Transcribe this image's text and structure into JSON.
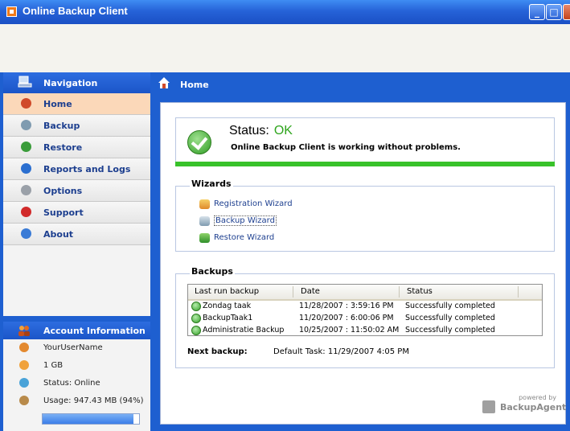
{
  "window": {
    "title": "Online Backup Client"
  },
  "nav": {
    "header": "Navigation",
    "items": [
      {
        "label": "Home",
        "icon": "home-icon",
        "color": "#d04a2a"
      },
      {
        "label": "Backup",
        "icon": "backup-icon",
        "color": "#7f9bb0"
      },
      {
        "label": "Restore",
        "icon": "restore-icon",
        "color": "#3a9c3a"
      },
      {
        "label": "Reports and Logs",
        "icon": "reports-icon",
        "color": "#2b6fd0"
      },
      {
        "label": "Options",
        "icon": "options-icon",
        "color": "#9aa0a8"
      },
      {
        "label": "Support",
        "icon": "support-icon",
        "color": "#d12a2a"
      },
      {
        "label": "About",
        "icon": "about-icon",
        "color": "#3a7bd6"
      }
    ]
  },
  "account": {
    "header": "Account Information",
    "username": "YourUserName",
    "quota": "1 GB",
    "status": "Status: Online",
    "usage": "Usage: 947.43 MB (94%)",
    "usage_fraction": 0.94
  },
  "home": {
    "title": "Home"
  },
  "status": {
    "label": "Status:",
    "value": "OK",
    "message": "Online Backup Client is working without problems."
  },
  "wizards": {
    "title": "Wizards",
    "items": [
      {
        "label": "Registration Wizard",
        "icon": "registration-icon"
      },
      {
        "label": "Backup Wizard",
        "icon": "backup-wizard-icon"
      },
      {
        "label": "Restore Wizard",
        "icon": "restore-wizard-icon"
      }
    ]
  },
  "backups": {
    "title": "Backups",
    "columns": [
      "Last run backup",
      "Date",
      "Status"
    ],
    "rows": [
      {
        "name": "Zondag taak",
        "date": "11/28/2007 : 3:59:16 PM",
        "status": "Successfully completed"
      },
      {
        "name": "BackupTaak1",
        "date": "11/20/2007 : 6:00:06 PM",
        "status": "Successfully completed"
      },
      {
        "name": "Administratie Backup",
        "date": "10/25/2007 : 11:50:02 AM",
        "status": "Successfully completed"
      }
    ],
    "next_label": "Next backup:",
    "next_value": "Default Task: 11/29/2007 4:05 PM"
  },
  "branding": {
    "powered_by": "powered by",
    "brand": "BackupAgent"
  }
}
